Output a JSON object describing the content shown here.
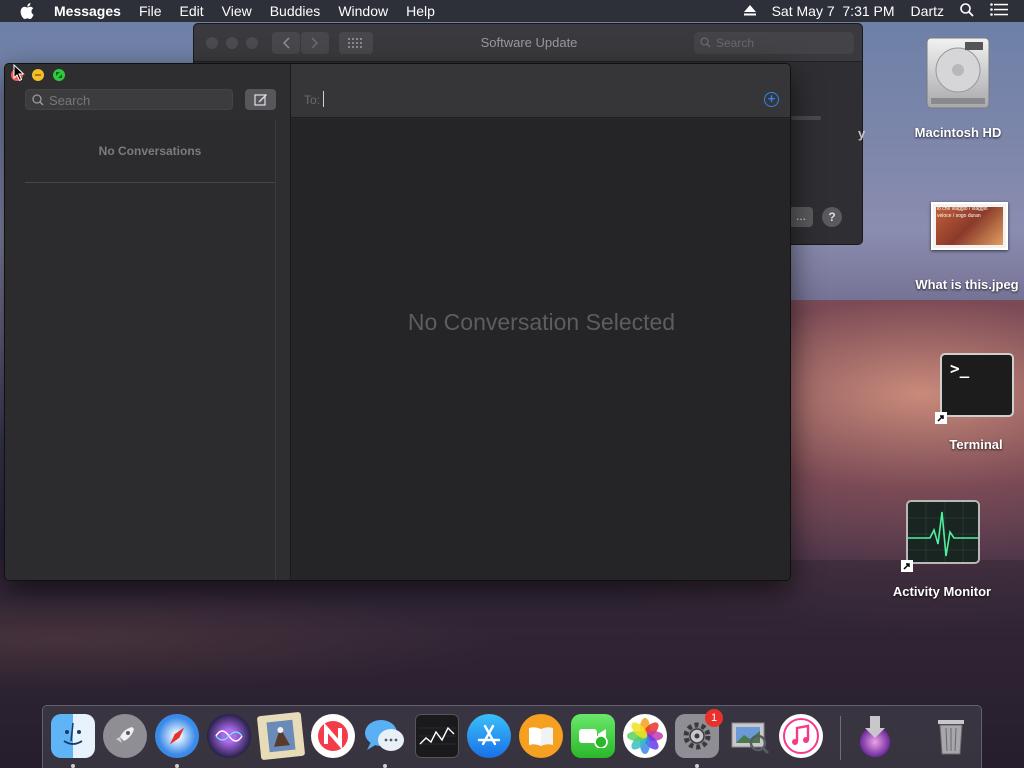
{
  "menubar": {
    "apple_icon": "apple-logo-icon",
    "app_name": "Messages",
    "items": [
      "File",
      "Edit",
      "View",
      "Buddies",
      "Window",
      "Help"
    ],
    "eject_icon": "eject-icon",
    "datetime": "Sat May 7  7:31 PM",
    "user": "Dartz",
    "spotlight_icon": "search-icon",
    "notification_icon": "list-icon"
  },
  "software_update": {
    "title": "Software Update",
    "search_placeholder": "Search",
    "partial_text": "y",
    "advanced_label": "...",
    "help_label": "?"
  },
  "messages": {
    "search_placeholder": "Search",
    "no_conversations": "No Conversations",
    "to_label": "To:",
    "to_placeholder": "",
    "add_label": "+",
    "no_conversation_selected": "No Conversation Selected"
  },
  "desktop": {
    "icons": [
      {
        "label": "Macintosh HD",
        "icon": "hard-drive-icon"
      },
      {
        "label": "What is this.jpeg",
        "icon": "image-file-icon"
      },
      {
        "label": "Terminal",
        "icon": "terminal-icon"
      },
      {
        "label": "Activity Monitor",
        "icon": "activity-monitor-icon"
      }
    ],
    "terminal_prompt": ">_",
    "jpeg_caption": "io che viaggio / viaggio veloce / sogo duran"
  },
  "dock": {
    "items": [
      {
        "name": "Finder",
        "icon": "finder-icon",
        "running": true
      },
      {
        "name": "Launchpad",
        "icon": "rocket-icon",
        "running": false
      },
      {
        "name": "Safari",
        "icon": "compass-icon",
        "running": true
      },
      {
        "name": "Siri",
        "icon": "siri-icon",
        "running": false
      },
      {
        "name": "Mail",
        "icon": "stamp-icon",
        "running": false
      },
      {
        "name": "News",
        "icon": "news-icon",
        "running": false
      },
      {
        "name": "Messages",
        "icon": "chat-bubble-icon",
        "running": true
      },
      {
        "name": "Stocks",
        "icon": "chart-icon",
        "running": false
      },
      {
        "name": "App Store",
        "icon": "app-store-icon",
        "running": false
      },
      {
        "name": "Books",
        "icon": "book-icon",
        "running": false
      },
      {
        "name": "FaceTime",
        "icon": "video-camera-icon",
        "running": false
      },
      {
        "name": "Photos",
        "icon": "flower-icon",
        "running": false
      },
      {
        "name": "System Preferences",
        "icon": "gear-icon",
        "running": true,
        "badge": "1"
      },
      {
        "name": "Preview",
        "icon": "preview-icon",
        "running": false
      },
      {
        "name": "iTunes",
        "icon": "music-note-icon",
        "running": false
      },
      {
        "name": "Downloads",
        "icon": "download-icon",
        "running": false
      },
      {
        "name": "Trash",
        "icon": "trash-icon",
        "running": false
      }
    ]
  },
  "colors": {
    "accent_blue": "#2f86ee",
    "close_red": "#f45952",
    "minimize_yellow": "#f4be2a",
    "maximize_green": "#2ec940",
    "badge_red": "#e8312a"
  }
}
